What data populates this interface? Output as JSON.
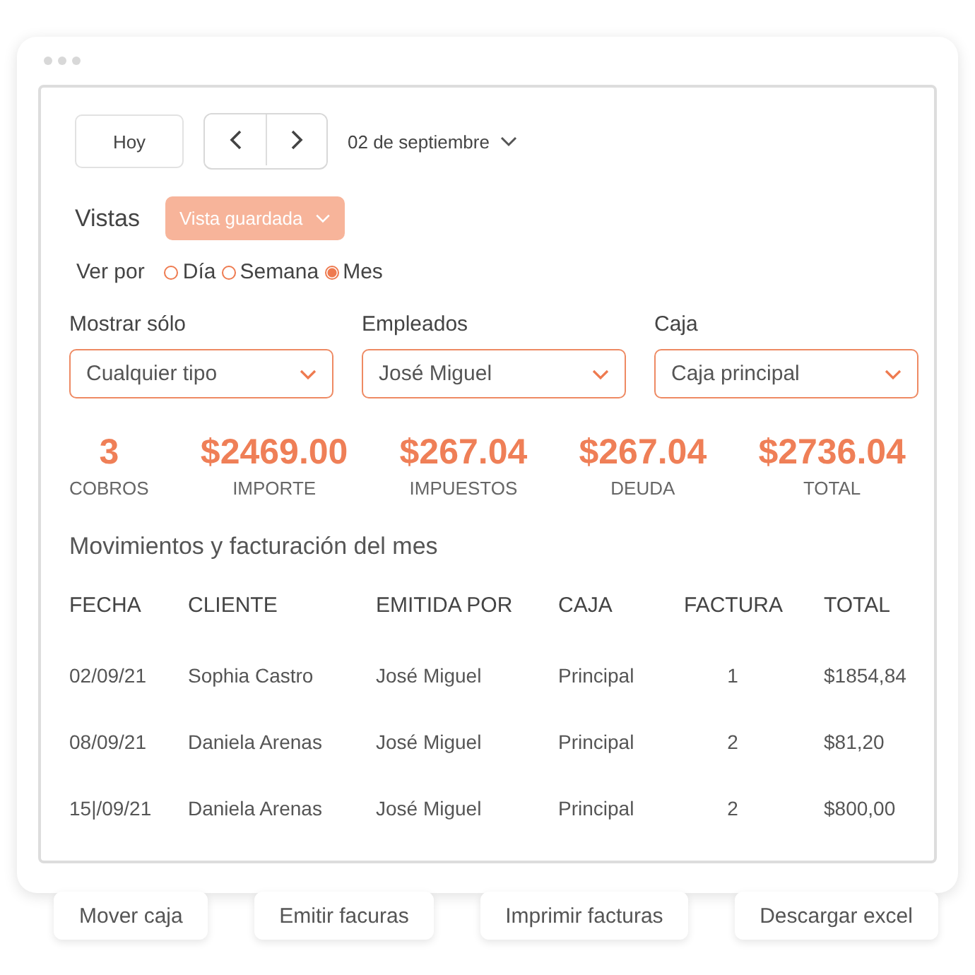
{
  "toolbar": {
    "today_button": "Hoy",
    "date": "02 de septiembre"
  },
  "views": {
    "label": "Vistas",
    "saved_view": "Vista guardada"
  },
  "view_by": {
    "label": "Ver por",
    "options": [
      {
        "label": "Día",
        "selected": false
      },
      {
        "label": "Semana",
        "selected": false
      },
      {
        "label": "Mes",
        "selected": true
      }
    ]
  },
  "filters": [
    {
      "label": "Mostrar sólo",
      "value": "Cualquier tipo"
    },
    {
      "label": "Empleados",
      "value": "José Miguel"
    },
    {
      "label": "Caja",
      "value": "Caja principal"
    }
  ],
  "stats": [
    {
      "value": "3",
      "label": "COBROS"
    },
    {
      "value": "$2469.00",
      "label": "IMPORTE"
    },
    {
      "value": "$267.04",
      "label": "IMPUESTOS"
    },
    {
      "value": "$267.04",
      "label": "DEUDA"
    },
    {
      "value": "$2736.04",
      "label": "TOTAL"
    }
  ],
  "table": {
    "title": "Movimientos y facturación del mes",
    "columns": [
      "FECHA",
      "CLIENTE",
      "EMITIDA POR",
      "CAJA",
      "FACTURA",
      "TOTAL"
    ],
    "rows": [
      [
        "02/09/21",
        "Sophia Castro",
        "José Miguel",
        "Principal",
        "1",
        "$1854,84"
      ],
      [
        "08/09/21",
        "Daniela Arenas",
        "José Miguel",
        "Principal",
        "2",
        "$81,20"
      ],
      [
        "15|/09/21",
        "Daniela Arenas",
        "José Miguel",
        "Principal",
        "2",
        "$800,00"
      ]
    ]
  },
  "actions": [
    "Mover caja",
    "Emitir facuras",
    "Imprimir facturas",
    "Descargar excel"
  ]
}
